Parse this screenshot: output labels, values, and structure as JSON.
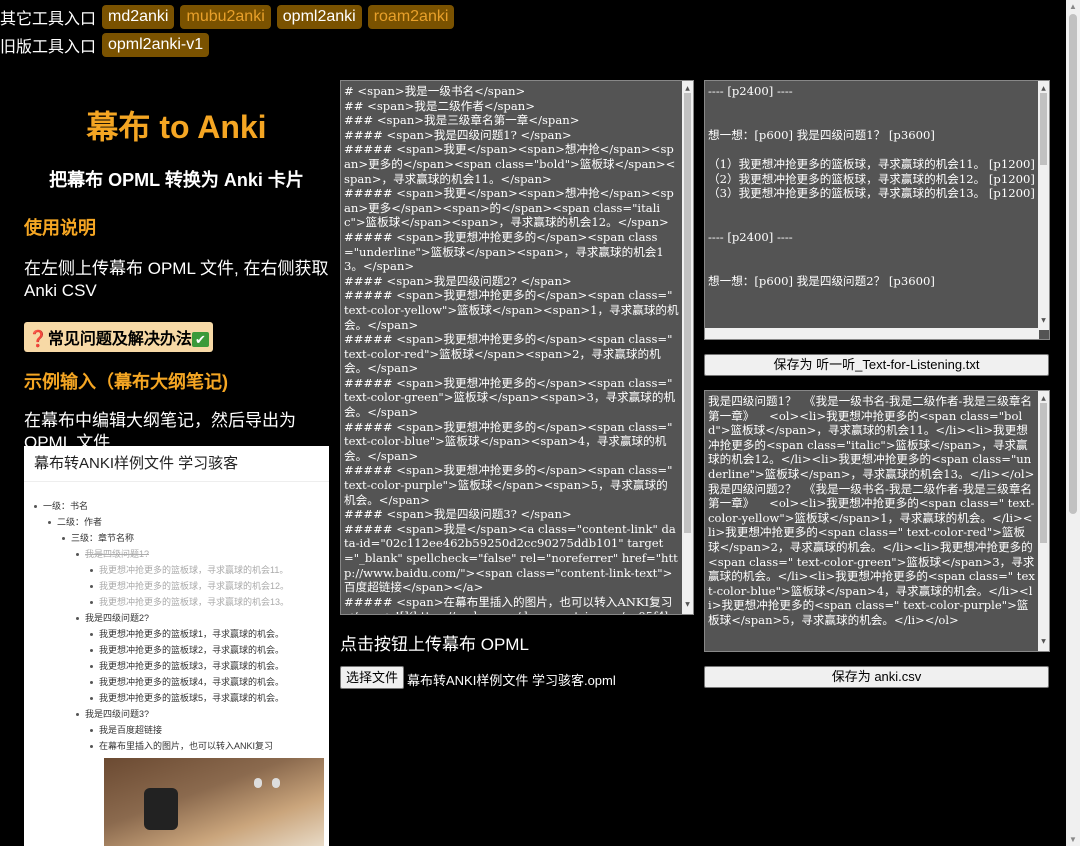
{
  "nav": {
    "other_label": "其它工具入口",
    "other_tools": [
      "md2anki",
      "mubu2anki",
      "opml2anki",
      "roam2anki"
    ],
    "old_label": "旧版工具入口",
    "old_tools": [
      "opml2anki-v1"
    ]
  },
  "left": {
    "brand": "幕布 to Anki",
    "subtitle": "把幕布 OPML 转换为 Anki 卡片",
    "usage_title": "使用说明",
    "usage_text": "在左侧上传幕布 OPML 文件, 在右侧获取 Anki CSV",
    "faq": "❓常见问题及解决办法",
    "faq_check": "✔",
    "example_title": "示例输入（幕布大纲笔记)",
    "example_text": "在幕布中编辑大纲笔记，然后导出为 OPML 文件"
  },
  "preview": {
    "title": "幕布转ANKI样例文件 学习骇客",
    "rows": [
      {
        "text": "一级：书名",
        "style": "normal"
      },
      {
        "text": "二级：作者",
        "style": "normal"
      },
      {
        "text": "三级：章节名称",
        "style": "normal"
      },
      {
        "text": "我是四级问题1?",
        "style": "done"
      },
      {
        "text": "我更想冲抢更多的篮板球，寻求赢球的机会11。",
        "style": "faded"
      },
      {
        "text": "我更想冲抢更多的篮板球，寻求赢球的机会12。",
        "style": "faded"
      },
      {
        "text": "我更想冲抢更多的篮板球，寻求赢球的机会13。",
        "style": "faded"
      },
      {
        "text": "我是四级问题2?",
        "style": "normal"
      },
      {
        "text": "我更想冲抢更多的篮板球1，寻求赢球的机会。",
        "style": "normal"
      },
      {
        "text": "我更想冲抢更多的篮板球2，寻求赢球的机会。",
        "style": "normal"
      },
      {
        "text": "我更想冲抢更多的篮板球3，寻求赢球的机会。",
        "style": "normal"
      },
      {
        "text": "我更想冲抢更多的篮板球4，寻求赢球的机会。",
        "style": "normal"
      },
      {
        "text": "我更想冲抢更多的篮板球5，寻求赢球的机会。",
        "style": "normal"
      },
      {
        "text": "我是四级问题3?",
        "style": "normal"
      },
      {
        "text": "我是百度超链接",
        "style": "normal"
      },
      {
        "text": "在幕布里插入的图片，也可以转入ANKI复习",
        "style": "normal"
      }
    ]
  },
  "opml_text": "# <span>我是一级书名</span>\n## <span>我是二级作者</span>\n### <span>我是三级章名第一章</span>\n#### <span>我是四级问题1? </span>\n##### <span>我更</span><span>想冲抢</span><span>更多的</span><span class=\"bold\">篮板球</span><span>，寻求赢球的机会11。</span>\n##### <span>我更</span><span>想冲抢</span><span>更多</span><span>的</span><span class=\"italic\">篮板球</span><span>，寻求赢球的机会12。</span>\n##### <span>我更想冲抢更多的</span><span class=\"underline\">篮板球</span><span>，寻求赢球的机会13。</span>\n#### <span>我是四级问题2? </span>\n##### <span>我更想冲抢更多的</span><span class=\" text-color-yellow\">篮板球</span><span>1，寻求赢球的机会。</span>\n##### <span>我更想冲抢更多的</span><span class=\" text-color-red\">篮板球</span><span>2，寻求赢球的机会。</span>\n##### <span>我更想冲抢更多的</span><span class=\" text-color-green\">篮板球</span><span>3，寻求赢球的机会。</span>\n##### <span>我更想冲抢更多的</span><span class=\" text-color-blue\">篮板球</span><span>4，寻求赢球的机会。</span>\n##### <span>我更想冲抢更多的</span><span class=\" text-color-purple\">篮板球</span><span>5，寻求赢球的机会。</span>\n#### <span>我是四级问题3? </span>\n##### <span>我是</span><a class=\"content-link\" data-id=\"02c112ee462b59250d2cc90275ddb101\" target=\"_blank\" spellcheck=\"false\" rel=\"noreferrer\" href=\"http://www.baidu.com/\"><span class=\"content-link-text\">百度超链接</span></a>\n##### <span>在幕布里插入的图片，也可以转入ANKI复习</span>![](https://mubu.com/document_image/ae05f4b5-",
  "listen_text": "---- [p2400] ----\n\n\n想一想：[p600] 我是四级问题1？ [p3600]\n\n（1）我更想冲抢更多的篮板球，寻求赢球的机会11。 [p1200]\n（2）我更想冲抢更多的篮板球，寻求赢球的机会12。 [p1200]\n（3）我更想冲抢更多的篮板球，寻求赢球的机会13。 [p1200]\n\n\n---- [p2400] ----\n\n\n想一想：[p600] 我是四级问题2？ [p3600]",
  "anki_text": "我是四级问题1？  《我是一级书名-我是二级作者-我是三级章名第一章》    <ol><li>我更想冲抢更多的<span class=\"bold\">篮板球</span>，寻求赢球的机会11。</li><li>我更想冲抢更多的<span class=\"italic\">篮板球</span>，寻求赢球的机会12。</li><li>我更想冲抢更多的<span class=\"underline\">篮板球</span>，寻求赢球的机会13。</li></ol>\n我是四级问题2？  《我是一级书名-我是二级作者-我是三级章名第一章》    <ol><li>我更想冲抢更多的<span class=\" text-color-yellow\">篮板球</span>1，寻求赢球的机会。</li><li>我更想冲抢更多的<span class=\" text-color-red\">篮板球</span>2，寻求赢球的机会。</li><li>我更想冲抢更多的<span class=\" text-color-green\">篮板球</span>3，寻求赢球的机会。</li><li>我更想冲抢更多的<span class=\" text-color-blue\">篮板球</span>4，寻求赢球的机会。</li><li>我更想冲抢更多的<span class=\" text-color-purple\">篮板球</span>5，寻求赢球的机会。</li></ol>",
  "buttons": {
    "save_listen": "保存为 听一听_Text-for-Listening.txt",
    "save_anki": "保存为 anki.csv",
    "choose_file": "选择文件"
  },
  "upload_label": "点击按钮上传幕布 OPML",
  "file_name": "幕布转ANKI样例文件 学习骇客.opml",
  "colors": {
    "accent": "#f5a623",
    "tag_bg": "#7a5200",
    "pane_bg": "#545454",
    "faq_bg": "#f7d9a6"
  }
}
